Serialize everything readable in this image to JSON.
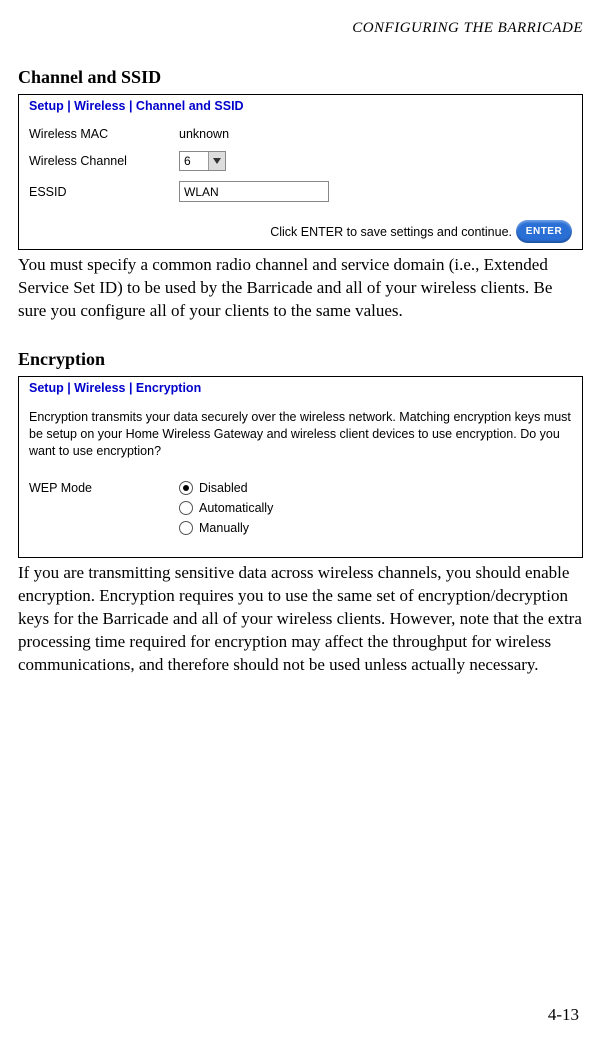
{
  "header": "CONFIGURING THE BARRICADE",
  "section1": {
    "title": "Channel and SSID",
    "breadcrumb": "Setup | Wireless | Channel and SSID",
    "rows": {
      "mac_label": "Wireless MAC",
      "mac_value": "unknown",
      "channel_label": "Wireless Channel",
      "channel_value": "6",
      "essid_label": "ESSID",
      "essid_value": "WLAN"
    },
    "footer_text": "Click ENTER to save settings and continue.",
    "enter_label": "ENTER",
    "body": "You must specify a common radio channel and service domain (i.e., Extended Service Set ID) to be used by the Barricade and all of your wireless clients. Be sure you configure all of your clients to the same values."
  },
  "section2": {
    "title": "Encryption",
    "breadcrumb": "Setup | Wireless | Encryption",
    "description": "Encryption transmits your data securely over the wireless network. Matching encryption keys must be setup on your Home Wireless Gateway and wireless client devices to use encryption. Do you want to use encryption?",
    "wep_label": "WEP Mode",
    "options": [
      "Disabled",
      "Automatically",
      "Manually"
    ],
    "selected": 0,
    "body": "If you are transmitting sensitive data across wireless channels, you should enable encryption. Encryption requires you to use the same set of encryption/decryption keys for the Barricade and all of your wireless clients. However, note that the extra processing time required for encryption may affect the throughput for wireless communications, and therefore should not be used unless actually necessary."
  },
  "page_number": "4-13"
}
